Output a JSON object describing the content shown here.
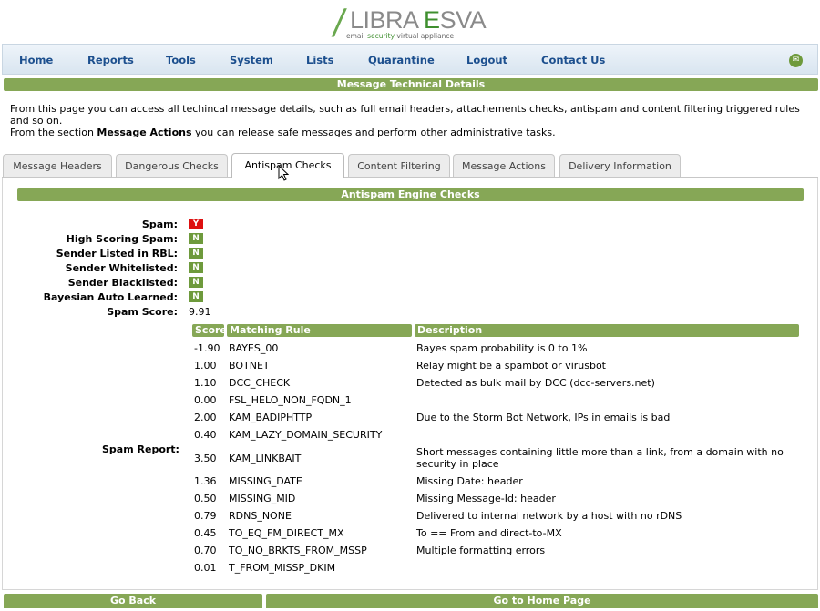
{
  "logo": {
    "prefix": "LIBRA ",
    "accent": "E",
    "suffix": "SVA",
    "sub_a": "email ",
    "sub_b": "security",
    "sub_c": " virtual appliance"
  },
  "nav": {
    "items": [
      "Home",
      "Reports",
      "Tools",
      "System",
      "Lists",
      "Quarantine",
      "Logout",
      "Contact Us"
    ],
    "mail_icon": "envelope-icon"
  },
  "header": {
    "title": "Message Technical Details"
  },
  "intro": {
    "line1": "From this page you can access all techincal message details, such as full email headers, attachements checks, antispam and content filtering triggered rules and so on.",
    "line2_a": "From the section ",
    "line2_b": "Message Actions",
    "line2_c": " you can release safe messages and perform other administrative tasks."
  },
  "tabs": [
    "Message Headers",
    "Dangerous Checks",
    "Antispam Checks",
    "Content Filtering",
    "Message Actions",
    "Delivery Information"
  ],
  "active_tab": "Antispam Checks",
  "section": {
    "title": "Antispam Engine Checks"
  },
  "checks": [
    {
      "label": "Spam:",
      "value": "Y"
    },
    {
      "label": "High Scoring Spam:",
      "value": "N"
    },
    {
      "label": "Sender Listed in RBL:",
      "value": "N"
    },
    {
      "label": "Sender Whitelisted:",
      "value": "N"
    },
    {
      "label": "Sender Blacklisted:",
      "value": "N"
    },
    {
      "label": "Bayesian Auto Learned:",
      "value": "N"
    }
  ],
  "spam_score": {
    "label": "Spam Score:",
    "value": "9.91"
  },
  "report": {
    "label": "Spam Report:",
    "columns": [
      "Score",
      "Matching Rule",
      "Description"
    ],
    "rows": [
      {
        "score": "-1.90",
        "rule": "BAYES_00",
        "desc": "Bayes spam probability is 0 to 1%"
      },
      {
        "score": "1.00",
        "rule": "BOTNET",
        "desc": "Relay might be a spambot or virusbot"
      },
      {
        "score": "1.10",
        "rule": "DCC_CHECK",
        "desc": "Detected as bulk mail by DCC (dcc-servers.net)"
      },
      {
        "score": "0.00",
        "rule": "FSL_HELO_NON_FQDN_1",
        "desc": ""
      },
      {
        "score": "2.00",
        "rule": "KAM_BADIPHTTP",
        "desc": "Due to the Storm Bot Network, IPs in emails is bad"
      },
      {
        "score": "0.40",
        "rule": "KAM_LAZY_DOMAIN_SECURITY",
        "desc": ""
      },
      {
        "score": "3.50",
        "rule": "KAM_LINKBAIT",
        "desc": "Short messages containing little more than a link, from a domain with no security in place"
      },
      {
        "score": "1.36",
        "rule": "MISSING_DATE",
        "desc": "Missing Date: header"
      },
      {
        "score": "0.50",
        "rule": "MISSING_MID",
        "desc": "Missing Message-Id: header"
      },
      {
        "score": "0.79",
        "rule": "RDNS_NONE",
        "desc": "Delivered to internal network by a host with no rDNS"
      },
      {
        "score": "0.45",
        "rule": "TO_EQ_FM_DIRECT_MX",
        "desc": "To == From and direct-to-MX"
      },
      {
        "score": "0.70",
        "rule": "TO_NO_BRKTS_FROM_MSSP",
        "desc": "Multiple formatting errors"
      },
      {
        "score": "0.01",
        "rule": "T_FROM_MISSP_DKIM",
        "desc": ""
      }
    ]
  },
  "footer": {
    "back": "Go Back",
    "home": "Go to Home Page"
  },
  "colors": {
    "green": "#86a756",
    "nav_text": "#1c4f8e",
    "spam_red": "#dd1010"
  }
}
